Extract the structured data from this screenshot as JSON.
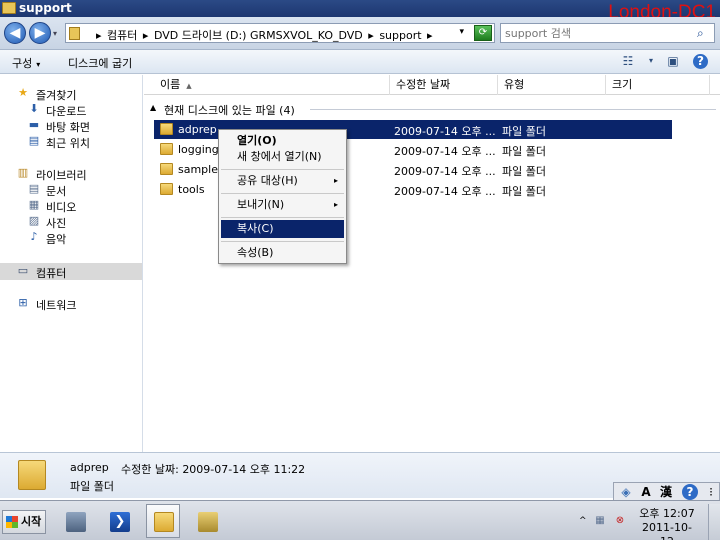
{
  "window": {
    "title": "support",
    "watermark": "London-DC1"
  },
  "address": {
    "crumbs": [
      "컴퓨터",
      "DVD 드라이브 (D:) GRMSXVOL_KO_DVD",
      "support"
    ],
    "sep": "▸",
    "dropdown": "▾",
    "refresh": "⟳",
    "search_placeholder": "support 검색"
  },
  "nav_buttons": {
    "back": "◀",
    "forward": "▶",
    "history": "▾"
  },
  "toolbar": {
    "organize": "구성",
    "organize_arrow": "▾",
    "burn": "디스크에 굽기",
    "view_icon": "☷",
    "view_arrow": "▾",
    "preview_icon": "▣",
    "help_icon": "?"
  },
  "nav": {
    "favorites": {
      "label": "즐겨찾기",
      "icon": "★",
      "icon_color": "#e8a817"
    },
    "favorites_items": [
      {
        "label": "다운로드",
        "icon": "⬇"
      },
      {
        "label": "바탕 화면",
        "icon": "▬"
      },
      {
        "label": "최근 위치",
        "icon": "▤"
      }
    ],
    "libraries": {
      "label": "라이브러리",
      "icon": "▥"
    },
    "library_items": [
      {
        "label": "문서",
        "icon": "▤"
      },
      {
        "label": "비디오",
        "icon": "▦"
      },
      {
        "label": "사진",
        "icon": "▨"
      },
      {
        "label": "음악",
        "icon": "♪"
      }
    ],
    "computer": {
      "label": "컴퓨터",
      "icon": "▭"
    },
    "network": {
      "label": "네트워크",
      "icon": "⊞"
    }
  },
  "columns": {
    "name": "이름",
    "name_sort": "▲",
    "modified": "수정한 날짜",
    "type": "유형",
    "size": "크기"
  },
  "group": {
    "toggle": "▲",
    "label": "현재 디스크에 있는 파일 (4)"
  },
  "files": [
    {
      "name": "adprep",
      "modified": "2009-07-14 오후 ...",
      "type": "파일 폴더",
      "selected": true
    },
    {
      "name": "logging",
      "modified": "2009-07-14 오후 ...",
      "type": "파일 폴더",
      "selected": false
    },
    {
      "name": "samples",
      "modified": "2009-07-14 오후 ...",
      "type": "파일 폴더",
      "selected": false
    },
    {
      "name": "tools",
      "modified": "2009-07-14 오후 ...",
      "type": "파일 폴더",
      "selected": false
    }
  ],
  "context_menu": {
    "open": "열기(O)",
    "open_new": "새 창에서 열기(N)",
    "share": "공유 대상(H)",
    "send_to": "보내기(N)",
    "copy": "복사(C)",
    "properties": "속성(B)",
    "submenu_arrow": "▸"
  },
  "details": {
    "name": "adprep",
    "modified_label": "수정한 날짜:",
    "modified": "2009-07-14 오후 11:22",
    "type": "파일 폴더"
  },
  "langbar": {
    "ime_icon": "◈",
    "mode_a": "A",
    "mode_han": "漢",
    "help": "?",
    "menu": "⁝"
  },
  "taskbar": {
    "start": "시작",
    "tray_caret": "^",
    "clock_time": "오후 12:07",
    "clock_date": "2011-10-12"
  }
}
